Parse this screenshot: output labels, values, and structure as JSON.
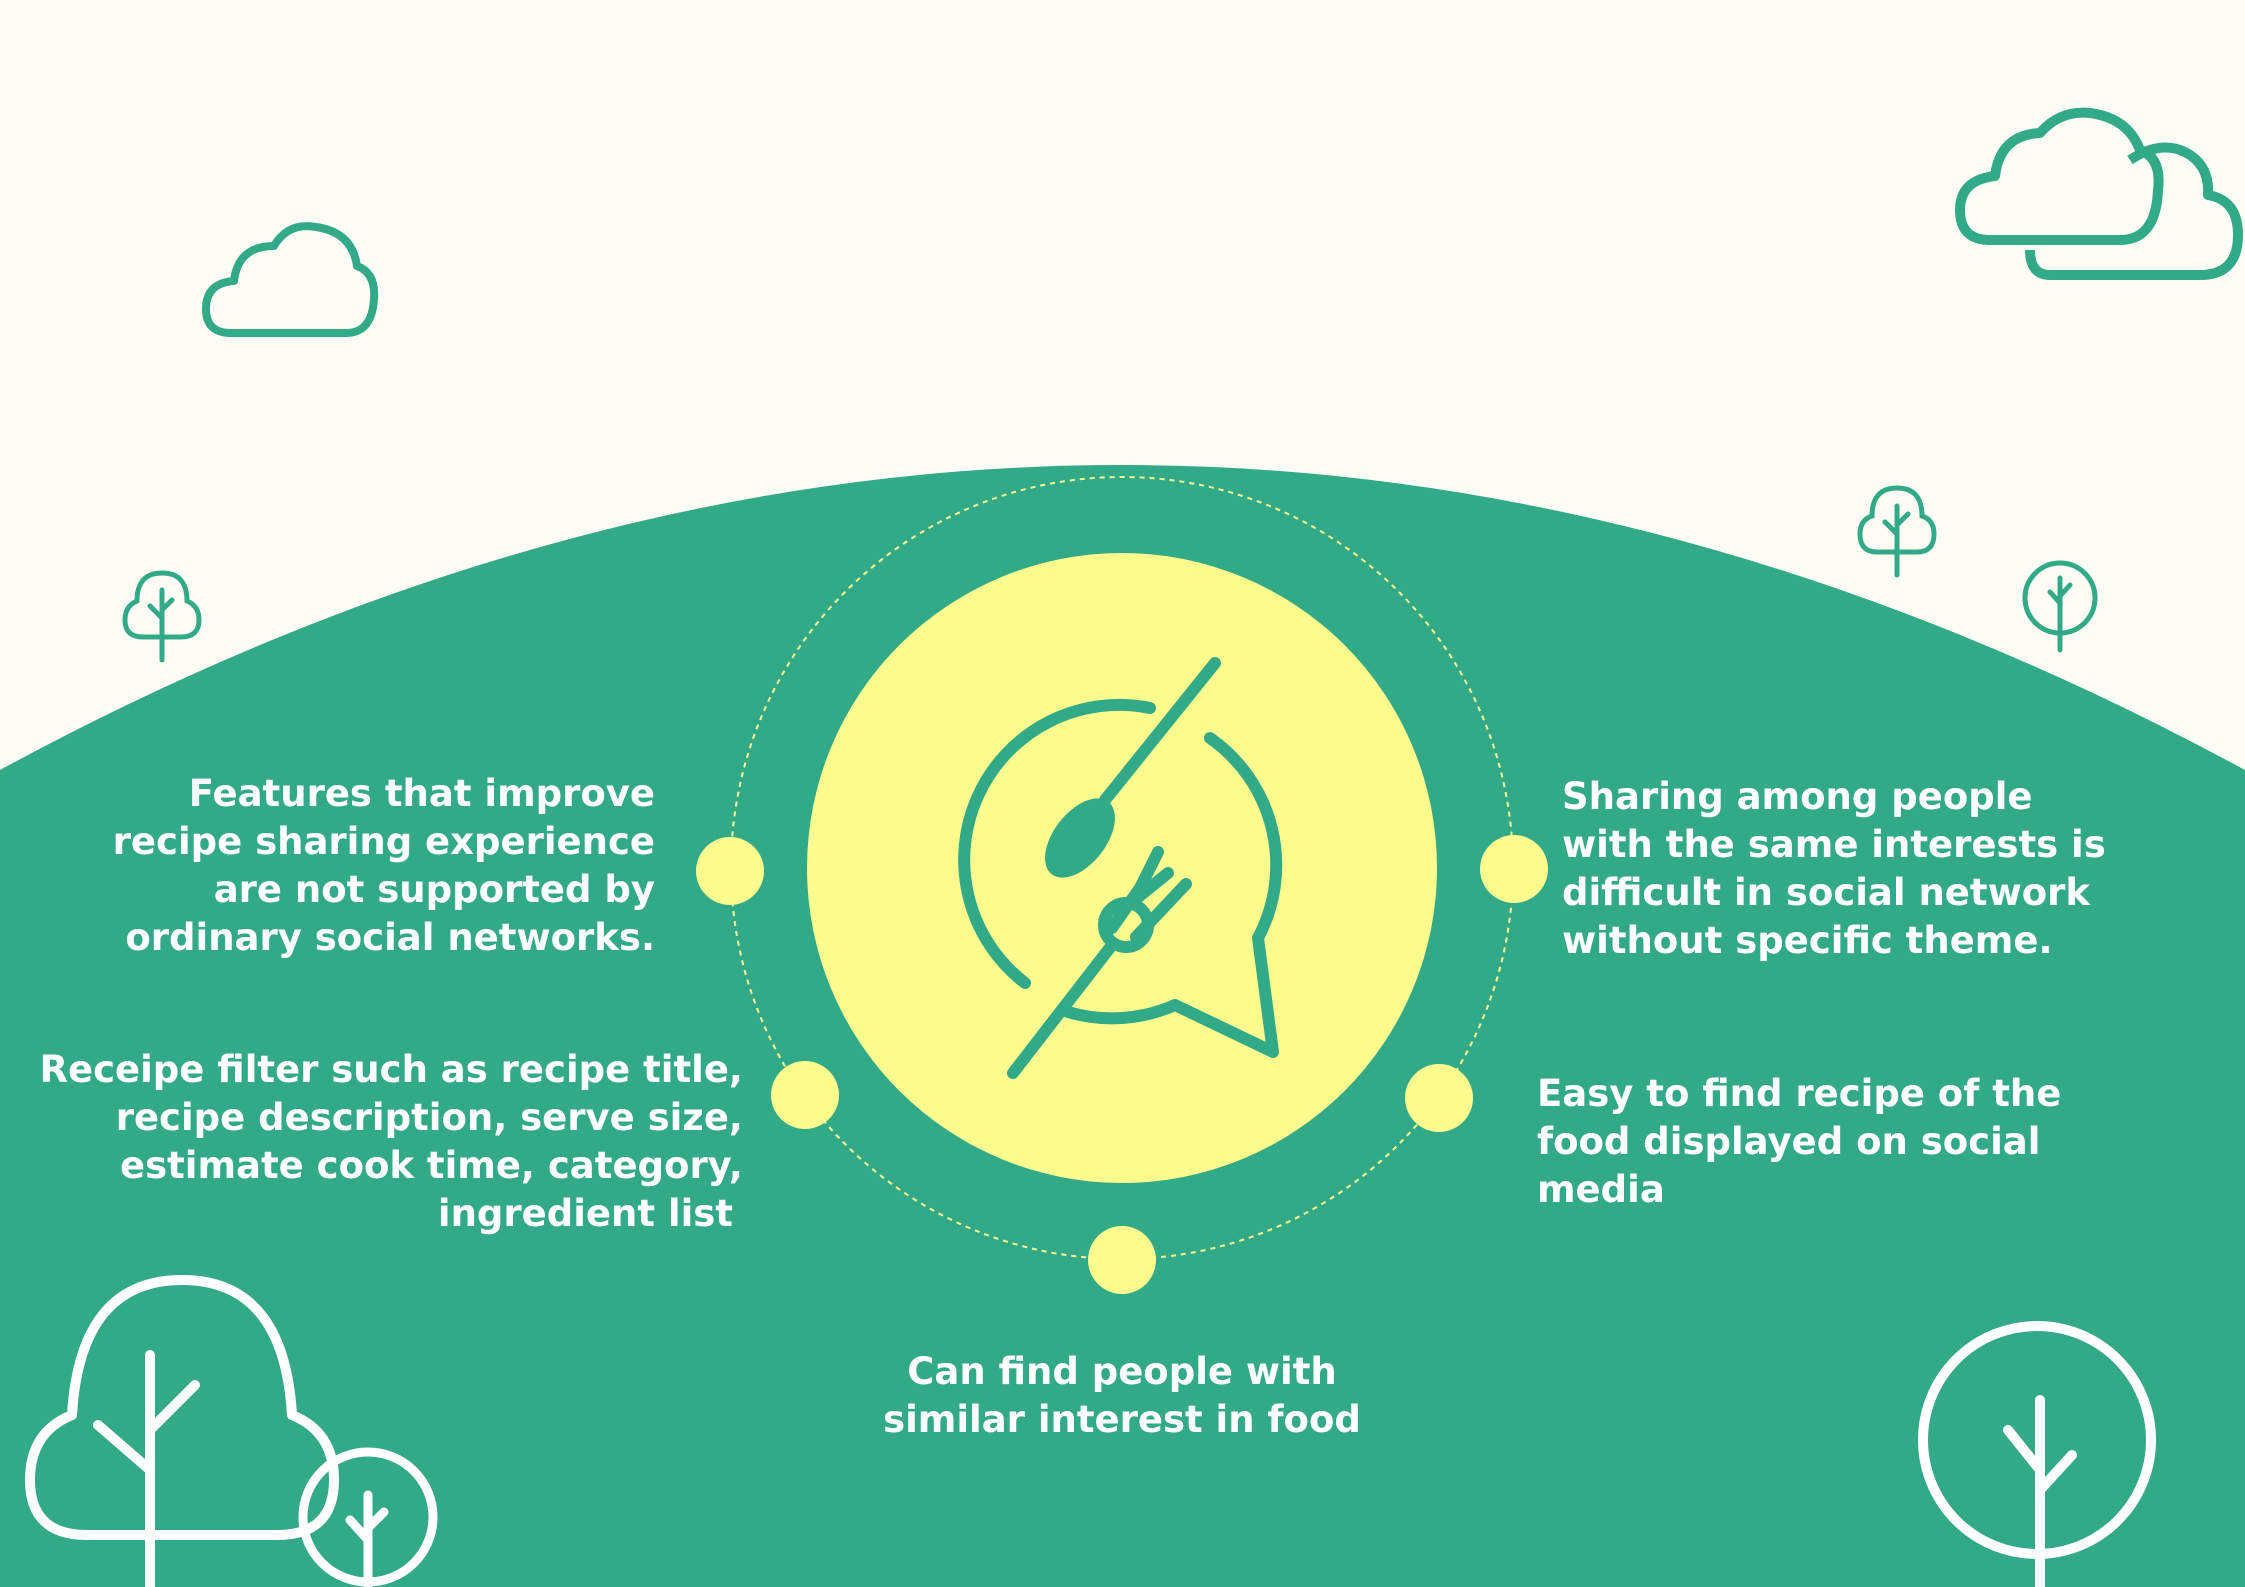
{
  "colors": {
    "background": "#FDFDF5",
    "green": "#32AA88",
    "yellow": "#FCFC8E",
    "white": "#FFFFFF"
  },
  "icons": {
    "center": "spoon-fork-chat-bubble-icon",
    "clouds": "cloud-outline-icon",
    "trees": "tree-outline-icon"
  },
  "points": {
    "top_left": {
      "lines": [
        "Features that improve",
        "recipe sharing experience",
        "are not supported by",
        "ordinary social networks."
      ]
    },
    "bottom_left": {
      "lines": [
        "Receipe filter such as recipe title,",
        "recipe description, serve size,",
        "estimate cook time, category,",
        "ingredient list"
      ]
    },
    "bottom_center": {
      "lines": [
        "Can find people with",
        "similar interest in food"
      ]
    },
    "top_right": {
      "lines": [
        "Sharing among people",
        "with the same interests is",
        "difficult in social network",
        "without specific theme."
      ]
    },
    "bottom_right": {
      "lines": [
        "Easy to find recipe of the",
        "food displayed on social",
        "media"
      ]
    }
  }
}
